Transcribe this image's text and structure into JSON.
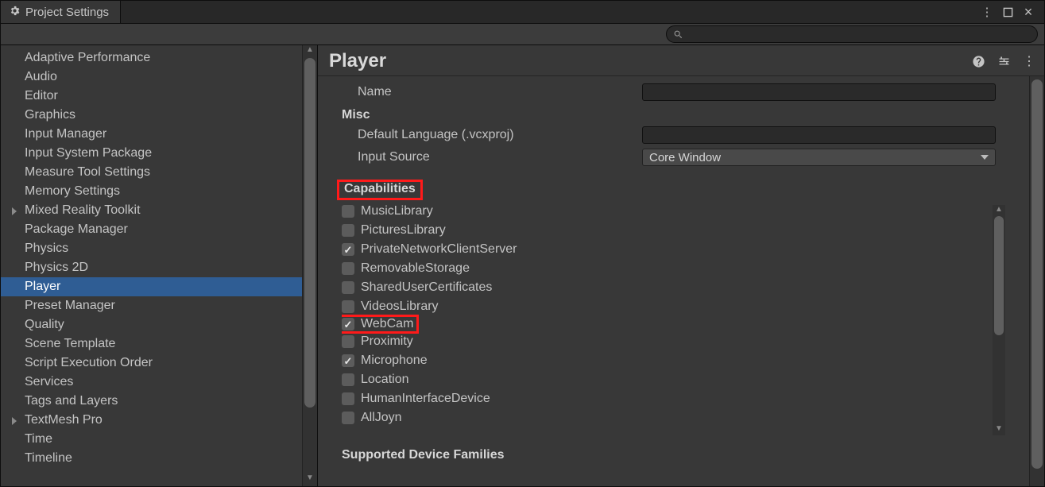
{
  "window": {
    "tab_title": "Project Settings"
  },
  "sidebar": {
    "items": [
      {
        "label": "Adaptive Performance",
        "selected": false,
        "children": false
      },
      {
        "label": "Audio",
        "selected": false,
        "children": false
      },
      {
        "label": "Editor",
        "selected": false,
        "children": false
      },
      {
        "label": "Graphics",
        "selected": false,
        "children": false
      },
      {
        "label": "Input Manager",
        "selected": false,
        "children": false
      },
      {
        "label": "Input System Package",
        "selected": false,
        "children": false
      },
      {
        "label": "Measure Tool Settings",
        "selected": false,
        "children": false
      },
      {
        "label": "Memory Settings",
        "selected": false,
        "children": false
      },
      {
        "label": "Mixed Reality Toolkit",
        "selected": false,
        "children": true
      },
      {
        "label": "Package Manager",
        "selected": false,
        "children": false
      },
      {
        "label": "Physics",
        "selected": false,
        "children": false
      },
      {
        "label": "Physics 2D",
        "selected": false,
        "children": false
      },
      {
        "label": "Player",
        "selected": true,
        "children": false
      },
      {
        "label": "Preset Manager",
        "selected": false,
        "children": false
      },
      {
        "label": "Quality",
        "selected": false,
        "children": false
      },
      {
        "label": "Scene Template",
        "selected": false,
        "children": false
      },
      {
        "label": "Script Execution Order",
        "selected": false,
        "children": false
      },
      {
        "label": "Services",
        "selected": false,
        "children": false
      },
      {
        "label": "Tags and Layers",
        "selected": false,
        "children": false
      },
      {
        "label": "TextMesh Pro",
        "selected": false,
        "children": true
      },
      {
        "label": "Time",
        "selected": false,
        "children": false
      },
      {
        "label": "Timeline",
        "selected": false,
        "children": false
      }
    ]
  },
  "main": {
    "title": "Player",
    "name_row": {
      "label": "Name",
      "value": ""
    },
    "misc_heading": "Misc",
    "default_language": {
      "label": "Default Language (.vcxproj)",
      "value": ""
    },
    "input_source": {
      "label": "Input Source",
      "value": "Core Window"
    },
    "capabilities_heading": "Capabilities",
    "capabilities": [
      {
        "label": "MusicLibrary",
        "checked": false,
        "highlight": false
      },
      {
        "label": "PicturesLibrary",
        "checked": false,
        "highlight": false
      },
      {
        "label": "PrivateNetworkClientServer",
        "checked": true,
        "highlight": false
      },
      {
        "label": "RemovableStorage",
        "checked": false,
        "highlight": false
      },
      {
        "label": "SharedUserCertificates",
        "checked": false,
        "highlight": false
      },
      {
        "label": "VideosLibrary",
        "checked": false,
        "highlight": false
      },
      {
        "label": "WebCam",
        "checked": true,
        "highlight": true
      },
      {
        "label": "Proximity",
        "checked": false,
        "highlight": false
      },
      {
        "label": "Microphone",
        "checked": true,
        "highlight": false
      },
      {
        "label": "Location",
        "checked": false,
        "highlight": false
      },
      {
        "label": "HumanInterfaceDevice",
        "checked": false,
        "highlight": false
      },
      {
        "label": "AllJoyn",
        "checked": false,
        "highlight": false
      }
    ],
    "supported_families_heading": "Supported Device Families"
  }
}
